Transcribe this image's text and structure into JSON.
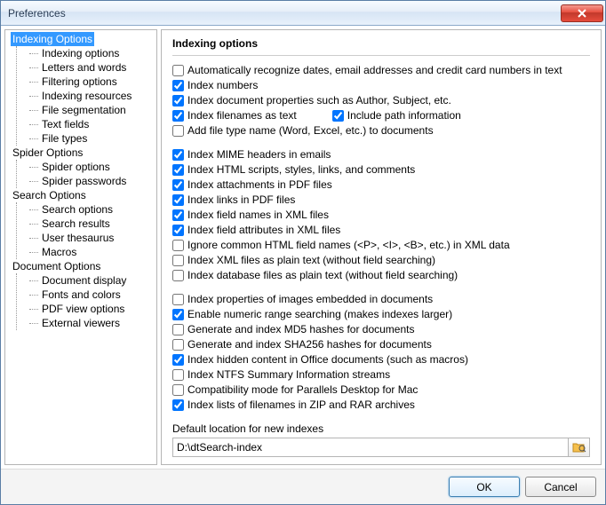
{
  "window": {
    "title": "Preferences"
  },
  "sidebar": {
    "groups": [
      {
        "header": "Indexing Options",
        "selected": true,
        "children": [
          "Indexing options",
          "Letters and words",
          "Filtering options",
          "Indexing resources",
          "File segmentation",
          "Text fields",
          "File types"
        ]
      },
      {
        "header": "Spider Options",
        "children": [
          "Spider options",
          "Spider passwords"
        ]
      },
      {
        "header": "Search Options",
        "children": [
          "Search options",
          "Search results",
          "User thesaurus",
          "Macros"
        ]
      },
      {
        "header": "Document Options",
        "children": [
          "Document display",
          "Fonts and colors",
          "PDF view options",
          "External viewers"
        ]
      }
    ]
  },
  "main": {
    "heading": "Indexing options",
    "opts": [
      {
        "label": "Automatically recognize dates, email addresses and credit card numbers in text",
        "checked": false
      },
      {
        "label": "Index numbers",
        "checked": true
      },
      {
        "label": "Index document properties such as Author, Subject, etc.",
        "checked": true
      },
      {
        "label": "Index filenames as text",
        "checked": true,
        "inline": {
          "label": "Include path information",
          "checked": true
        }
      },
      {
        "label": "Add file type name (Word, Excel, etc.) to documents",
        "checked": false
      },
      {
        "gap": true
      },
      {
        "label": "Index MIME headers in emails",
        "checked": true
      },
      {
        "label": "Index HTML scripts, styles, links, and comments",
        "checked": true
      },
      {
        "label": "Index attachments in PDF files",
        "checked": true
      },
      {
        "label": "Index links in PDF files",
        "checked": true
      },
      {
        "label": "Index field names in XML files",
        "checked": true
      },
      {
        "label": "Index field attributes in XML files",
        "checked": true
      },
      {
        "label": "Ignore common HTML field names (<P>, <I>, <B>, etc.) in XML data",
        "checked": false
      },
      {
        "label": "Index XML files as plain text (without field searching)",
        "checked": false
      },
      {
        "label": "Index database files as plain text (without field searching)",
        "checked": false
      },
      {
        "gap": true
      },
      {
        "label": "Index properties of images embedded in documents",
        "checked": false
      },
      {
        "label": "Enable numeric range searching (makes indexes larger)",
        "checked": true
      },
      {
        "label": "Generate and index MD5 hashes for documents",
        "checked": false
      },
      {
        "label": "Generate and index SHA256 hashes for documents",
        "checked": false
      },
      {
        "label": "Index hidden content in Office documents (such as macros)",
        "checked": true
      },
      {
        "label": "Index NTFS Summary Information streams",
        "checked": false
      },
      {
        "label": "Compatibility mode for Parallels Desktop for Mac",
        "checked": false
      },
      {
        "label": "Index lists of filenames in ZIP and RAR archives",
        "checked": true
      }
    ],
    "default_loc_label": "Default location for new indexes",
    "default_loc_value": "D:\\dtSearch-index"
  },
  "footer": {
    "ok": "OK",
    "cancel": "Cancel"
  }
}
